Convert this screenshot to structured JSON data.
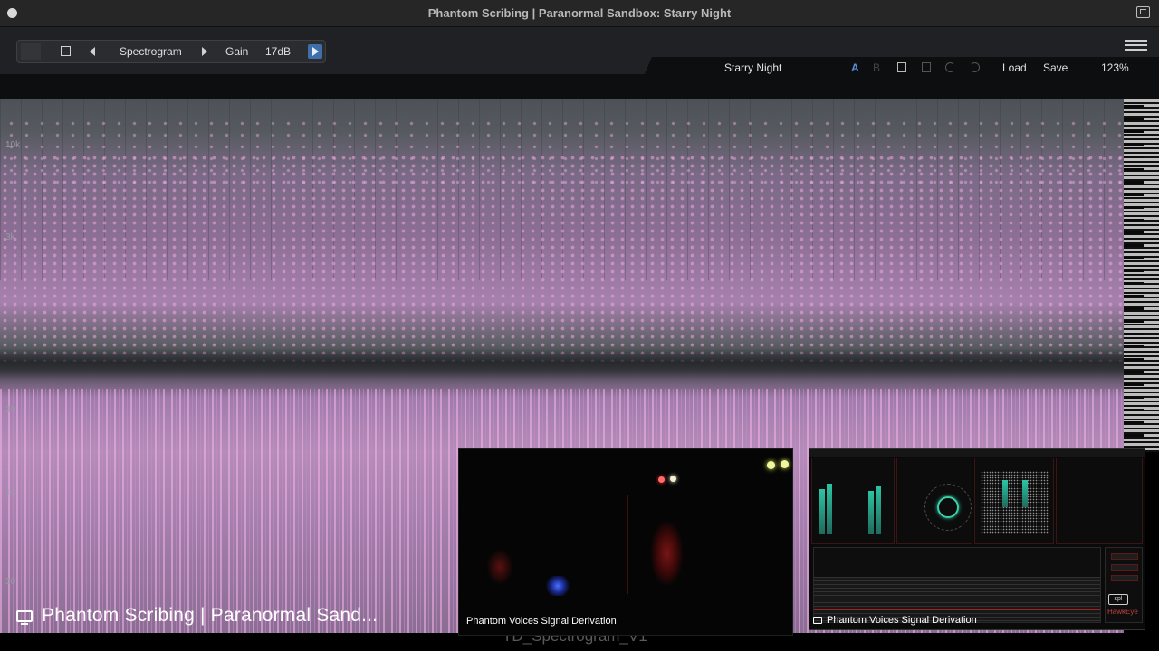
{
  "window": {
    "title": "Phantom Scribing | Paranormal Sandbox: Starry Night"
  },
  "toolbar": {
    "view_label": "Spectrogram",
    "gain_label": "Gain",
    "gain_value": "17dB"
  },
  "header": {
    "preset_name": "Starry Night",
    "ab_a": "A",
    "ab_b": "B",
    "load_label": "Load",
    "save_label": "Save",
    "zoom": "123%"
  },
  "spectrogram": {
    "freq_labels": [
      "10k",
      "3k",
      "30",
      "10",
      "30"
    ]
  },
  "overlays": {
    "stream_caption": "Phantom Scribing | Paranormal Sand...",
    "camera_caption": "Phantom Voices Signal Derivation",
    "meter_caption": "Phantom Voices Signal Derivation",
    "bottom_ghost_text": "TD_Spectrogram_V1",
    "meter_brand": "HawkEye",
    "meter_logo": "spl"
  },
  "colors": {
    "accent_blue": "#5a8ed6",
    "spectrogram_pink": "#f2a6e3",
    "meter_teal": "#2cc4a4"
  }
}
